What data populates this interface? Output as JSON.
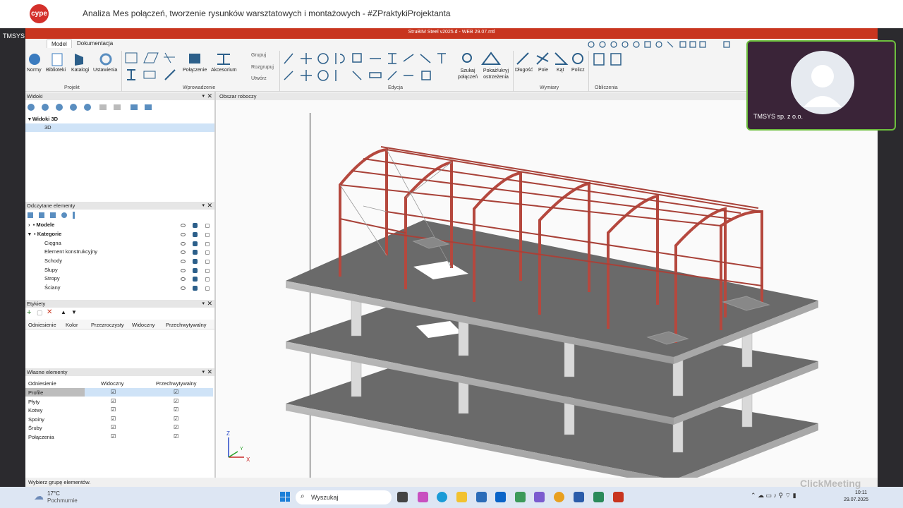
{
  "webinar": {
    "title": "Analiza Mes połączeń, tworzenie rysunków warsztatowych i montażowych - #ZPraktykiProjektanta",
    "logo_text": "cype"
  },
  "presenter": {
    "left_label": "TMSYS sp. z o.o.",
    "video_name": "TMSYS sp. z o.o."
  },
  "app": {
    "title": "StruBIM Steel v2025.d - WEB 29.07.mtl"
  },
  "ribbon": {
    "tabs": [
      "Model",
      "Dokumentacja"
    ],
    "project": {
      "buttons": [
        "Normy",
        "Biblioteki",
        "Katalogi",
        "Ustawienia"
      ],
      "label": "Projekt"
    },
    "intro": {
      "buttons": [
        "Połączenie",
        "Akcesorium"
      ],
      "small": [
        "Grupuj",
        "Rozgrupuj",
        "Utwórz"
      ],
      "label": "Wprowadzenie"
    },
    "edit": {
      "buttons": [
        "Szukaj połączeń",
        "Pokaż/ukryj ostrzeżenia"
      ],
      "label": "Edycja"
    },
    "dims": {
      "buttons": [
        "Długość",
        "Pole",
        "Kąt",
        "Policz"
      ],
      "label": "Wymiary"
    },
    "calc": {
      "label": "Obliczenia"
    }
  },
  "panels": {
    "views": {
      "title": "Widoki",
      "group": "Widoki 3D",
      "item": "3D"
    },
    "read": {
      "title": "Odczytane elementy",
      "models": "Modele",
      "categories": "Kategorie",
      "items": [
        "Cięgna",
        "Element konstrukcyjny",
        "Schody",
        "Słupy",
        "Stropy",
        "Ściany"
      ]
    },
    "labels": {
      "title": "Etykiety",
      "columns": [
        "Odniesienie",
        "Kolor",
        "Przezroczysty",
        "Widoczny",
        "Przechwytywalny"
      ]
    },
    "own": {
      "title": "Własne elementy",
      "columns": [
        "Odniesienie",
        "Widoczny",
        "Przechwytywalny"
      ],
      "rows": [
        "Profile",
        "Płyty",
        "Kotwy",
        "Spoiny",
        "Śruby",
        "Połączenia"
      ]
    }
  },
  "workspace": {
    "title": "Obszar roboczy",
    "axes": {
      "z": "Z",
      "y": "Y",
      "x": "X"
    }
  },
  "status": "Wybierz grupę elementów.",
  "taskbar": {
    "weather_temp": "17°C",
    "weather_desc": "Pochmurnie",
    "search": "Wyszukaj",
    "time": "10:11",
    "date": "29.07.2025"
  },
  "watermark": "ClickMeeting",
  "colors": {
    "brand": "#c8351f",
    "steel": "#b5483e",
    "slab": "#6e6e6e"
  }
}
